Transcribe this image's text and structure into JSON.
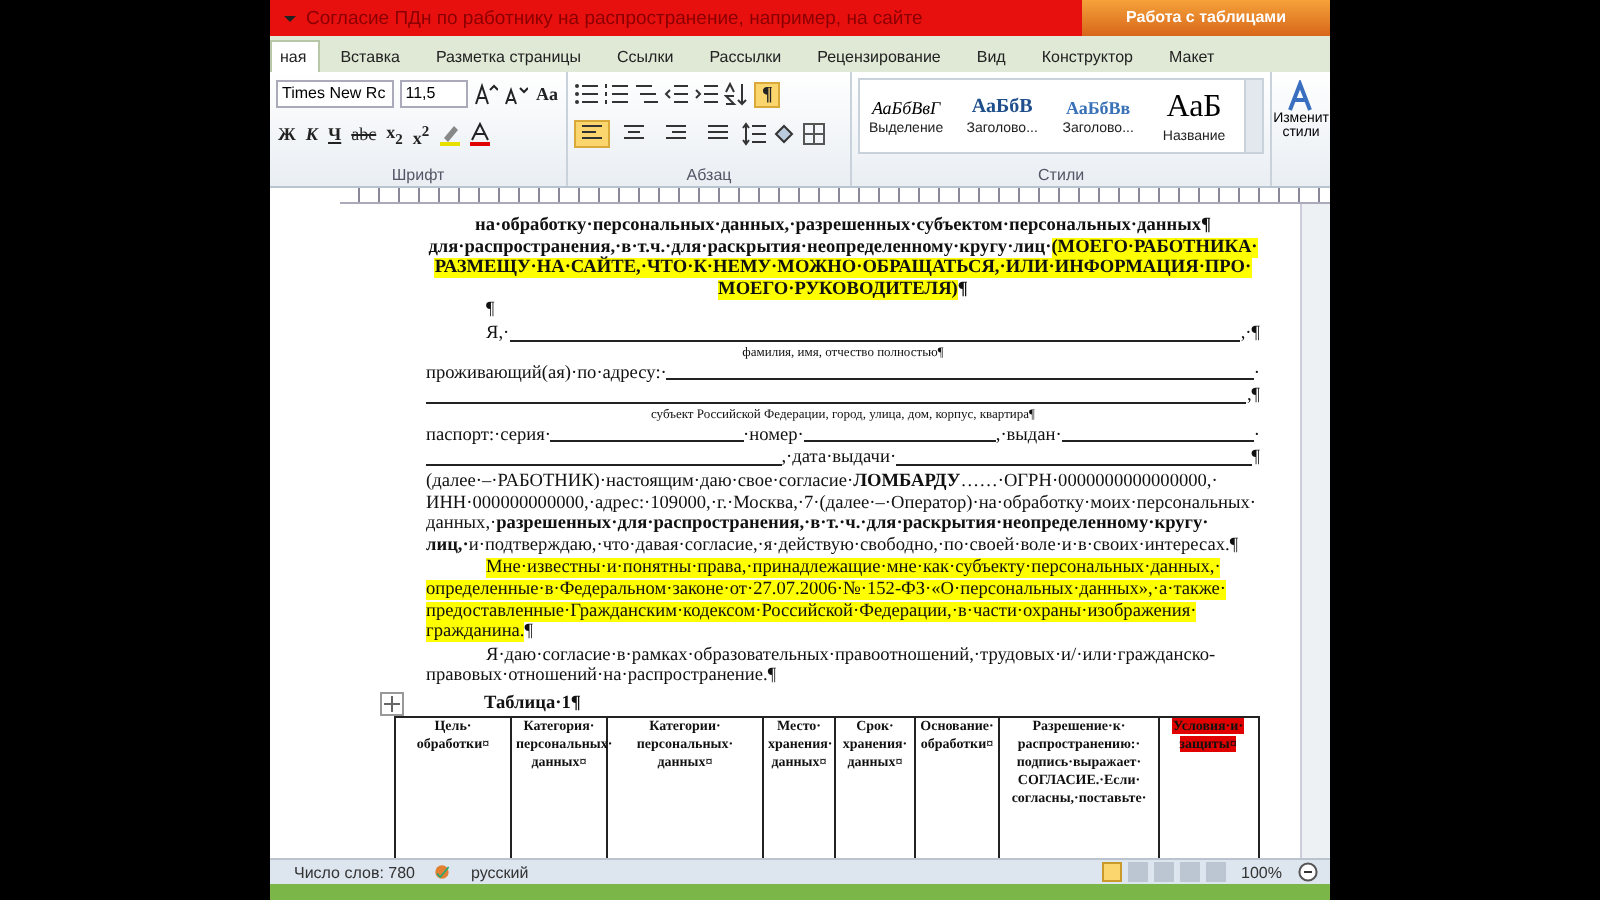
{
  "title_bar": {
    "title": "Согласие ПДн по работнику на распространение, например, на сайте",
    "context_tab": "Работа с таблицами"
  },
  "tabs": [
    {
      "label": "ная",
      "selected": true
    },
    {
      "label": "Вставка",
      "selected": false
    },
    {
      "label": "Разметка страницы",
      "selected": false
    },
    {
      "label": "Ссылки",
      "selected": false
    },
    {
      "label": "Рассылки",
      "selected": false
    },
    {
      "label": "Рецензирование",
      "selected": false
    },
    {
      "label": "Вид",
      "selected": false
    },
    {
      "label": "Конструктор",
      "selected": false
    },
    {
      "label": "Макет",
      "selected": false
    }
  ],
  "ribbon": {
    "font_name": "Times New Rc",
    "font_size": "11,5",
    "case_button": "Aa",
    "font_buttons": [
      "Ж",
      "К",
      "Ч",
      "abc",
      "x$_{2}$",
      "x$^{2}$"
    ],
    "show_marks": {
      "label": "¶",
      "on": true
    },
    "align": [
      {
        "selected": true
      },
      {
        "selected": false
      },
      {
        "selected": false
      },
      {
        "selected": false
      }
    ],
    "groups": [
      "Шрифт",
      "Абзац",
      "Стили"
    ],
    "styles": [
      {
        "kind": "emphasis",
        "sample": "АаБбВвГ",
        "label": "Выделение"
      },
      {
        "kind": "heading1",
        "sample": "АаБбВ",
        "label": "Заголово..."
      },
      {
        "kind": "heading2",
        "sample": "АаБбВв",
        "label": "Заголово..."
      },
      {
        "kind": "title",
        "sample": "АаБ",
        "label": "Название"
      }
    ],
    "change_styles": [
      "Изменит",
      "стили"
    ]
  },
  "document": {
    "blocks": [
      {
        "kind": "heading",
        "segments": [
          {
            "text": "на·обработку·персональных·данных,·разрешенных·субъектом·персональных·данных¶",
            "bold": true,
            "highlight": false
          }
        ]
      },
      {
        "kind": "heading",
        "segments": [
          {
            "text": "для·распространения,·в·т.ч.·для·раскрытия·неопределенному·кругу·лиц·",
            "bold": true,
            "highlight": false
          },
          {
            "text": "(МОЕГО·РАБОТНИКА·РАЗМЕЩУ·НА·САЙТЕ,·ЧТО·К·НЕМУ·МОЖНО·ОБРАЩАТЬСЯ,·ИЛИ·ИНФОРМАЦИЯ·ПРО·МОЕГО·РУКОВОДИТЕЛЯ)",
            "bold": true,
            "highlight": true
          },
          {
            "text": "¶",
            "bold": true,
            "highlight": false
          }
        ]
      },
      {
        "kind": "blank",
        "text": "¶"
      },
      {
        "kind": "field",
        "indent": true,
        "parts": [
          {
            "kind": "text",
            "text": "Я,·"
          },
          {
            "kind": "line"
          },
          {
            "kind": "text",
            "text": ",·¶"
          }
        ]
      },
      {
        "kind": "caption",
        "text": "фамилия, имя, отчество полностью¶"
      },
      {
        "kind": "field",
        "indent": false,
        "parts": [
          {
            "kind": "text",
            "text": "проживающий(ая)·по·адресу:·"
          },
          {
            "kind": "line"
          },
          {
            "kind": "text",
            "text": "·"
          }
        ]
      },
      {
        "kind": "field",
        "indent": false,
        "parts": [
          {
            "kind": "line"
          },
          {
            "kind": "text",
            "text": ",¶"
          }
        ]
      },
      {
        "kind": "caption",
        "text": "субъект Российской Федерации, город, улица, дом, корпус, квартира¶"
      },
      {
        "kind": "field",
        "indent": false,
        "parts": [
          {
            "kind": "text",
            "text": "паспорт:·серия·"
          },
          {
            "kind": "line"
          },
          {
            "kind": "text",
            "text": "·номер·"
          },
          {
            "kind": "line"
          },
          {
            "kind": "text",
            "text": ",·выдан·"
          },
          {
            "kind": "line"
          },
          {
            "kind": "text",
            "text": "·"
          }
        ]
      },
      {
        "kind": "field",
        "indent": false,
        "parts": [
          {
            "kind": "line"
          },
          {
            "kind": "text",
            "text": ",·дата·выдачи·"
          },
          {
            "kind": "line"
          },
          {
            "kind": "text",
            "text": "¶"
          }
        ]
      },
      {
        "kind": "para",
        "indent": false,
        "segments": [
          {
            "text": "(далее·–·РАБОТНИК)·настоящим·даю·свое·согласие·",
            "bold": false,
            "highlight": false
          },
          {
            "text": "ЛОМБАРДУ",
            "bold": true,
            "highlight": false
          },
          {
            "text": "……·ОГРН·0000000000000000,·ИНН·000000000000,·адрес:·109000,·г.·Москва,·7·(далее·–·Оператор)·на·обработку·моих·персональных·данных,·",
            "bold": false,
            "highlight": false
          },
          {
            "text": "разрешенных·для·распространения,·в·т.·ч.·для·раскрытия·неопределенному·кругу·лиц,·",
            "bold": true,
            "highlight": false
          },
          {
            "text": "и·подтверждаю,·что·давая·согласие,·я·действую·свободно,·по·своей·воле·и·в·своих·интересах.¶",
            "bold": false,
            "highlight": false
          }
        ]
      },
      {
        "kind": "para",
        "indent": true,
        "segments": [
          {
            "text": "Мне·известны·и·понятны·права,·принадлежащие·мне·как·субъекту·персональных·данных,·определенные·в·Федеральном·законе·от·27.07.2006·№·152-ФЗ·«О·персональных·данных»,·а·также·предоставленные·Гражданским·кодексом·Российской·Федерации,·в·части·охраны·изображения·гражданина.",
            "bold": false,
            "highlight": true
          },
          {
            "text": "¶",
            "bold": false,
            "highlight": false
          }
        ]
      },
      {
        "kind": "para",
        "indent": true,
        "segments": [
          {
            "text": "Я·даю·согласие·в·рамках·образовательных·правоотношений,·трудовых·и/·или·гражданско-правовых·отношений·на·распространение.¶",
            "bold": false,
            "highlight": false
          }
        ]
      },
      {
        "kind": "table_title",
        "text": "Таблица·1¶"
      }
    ],
    "table": {
      "columns": [
        {
          "label": "Цель·обработки¤",
          "highlight": false
        },
        {
          "label": "Категория·персональных·данных¤",
          "highlight": false
        },
        {
          "label": "Категории·персональных·данных¤",
          "highlight": false
        },
        {
          "label": "Место·хранения·данных¤",
          "highlight": false
        },
        {
          "label": "Срок·хранения·данных¤",
          "highlight": false
        },
        {
          "label": "Основание·обработки¤",
          "highlight": false
        },
        {
          "label": "Разрешение·к·распространению:·подпись·выражает·СОГЛАСИЕ.·Если·согласны,·поставьте·",
          "highlight": false
        },
        {
          "label": "Условия·и·защиты¤",
          "highlight": true
        }
      ]
    }
  },
  "status_bar": {
    "words": "Число слов: 780",
    "language": "русский",
    "views": [
      {
        "selected": true
      },
      {
        "selected": false
      },
      {
        "selected": false
      },
      {
        "selected": false
      },
      {
        "selected": false
      }
    ],
    "zoom": "100%"
  }
}
